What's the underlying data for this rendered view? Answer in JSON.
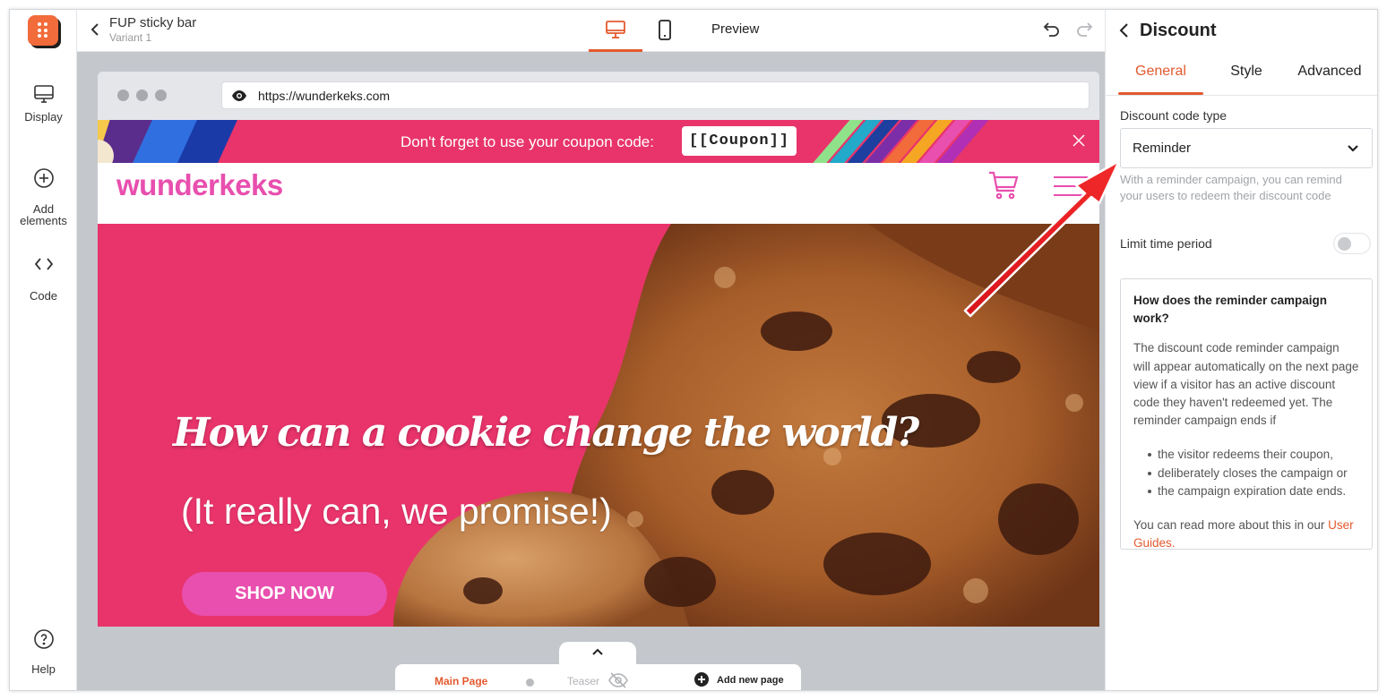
{
  "app": {
    "colors": {
      "accent": "#e3592e",
      "brand_pink": "#e8346b",
      "brand_logo": "#e84fae"
    }
  },
  "rail": {
    "items": [
      {
        "label": "Display",
        "icon": "monitor-icon"
      },
      {
        "label": "Add elements",
        "icon": "plus-circle-icon"
      },
      {
        "label": "Code",
        "icon": "code-icon"
      },
      {
        "label": "Help",
        "icon": "question-circle-icon"
      }
    ]
  },
  "topbar": {
    "title": "FUP sticky bar",
    "subtitle": "Variant 1",
    "preview_label": "Preview",
    "active_device": "desktop"
  },
  "browser": {
    "url": "https://wunderkeks.com"
  },
  "site": {
    "sticky_text": "Don't forget to use your coupon code:",
    "coupon": "[[Coupon]]",
    "brand": "wunderkeks",
    "hero_title": "How can a cookie change the world?",
    "hero_subtitle": "(It really can, we promise!)",
    "cta": "SHOP NOW"
  },
  "pages": {
    "main": "Main Page",
    "teaser": "Teaser",
    "add": "Add new page"
  },
  "panel": {
    "title": "Discount",
    "tabs": [
      "General",
      "Style",
      "Advanced"
    ],
    "active_tab": "General",
    "discount_code_type_label": "Discount code type",
    "discount_code_type_value": "Reminder",
    "helper": "With a reminder campaign, you can remind your users to redeem their discount code",
    "limit_label": "Limit time period",
    "limit_enabled": false,
    "info": {
      "heading": "How does the reminder campaign work?",
      "body": "The discount code reminder campaign will appear automatically on the next page view if a visitor has an active discount code they haven't redeemed yet. The reminder campaign ends if",
      "bullets": [
        "the visitor redeems their coupon,",
        "deliberately closes the campaign or",
        "the campaign expiration date ends."
      ],
      "footer_prefix": "You can read more about this in our ",
      "footer_link": "User Guides."
    }
  }
}
